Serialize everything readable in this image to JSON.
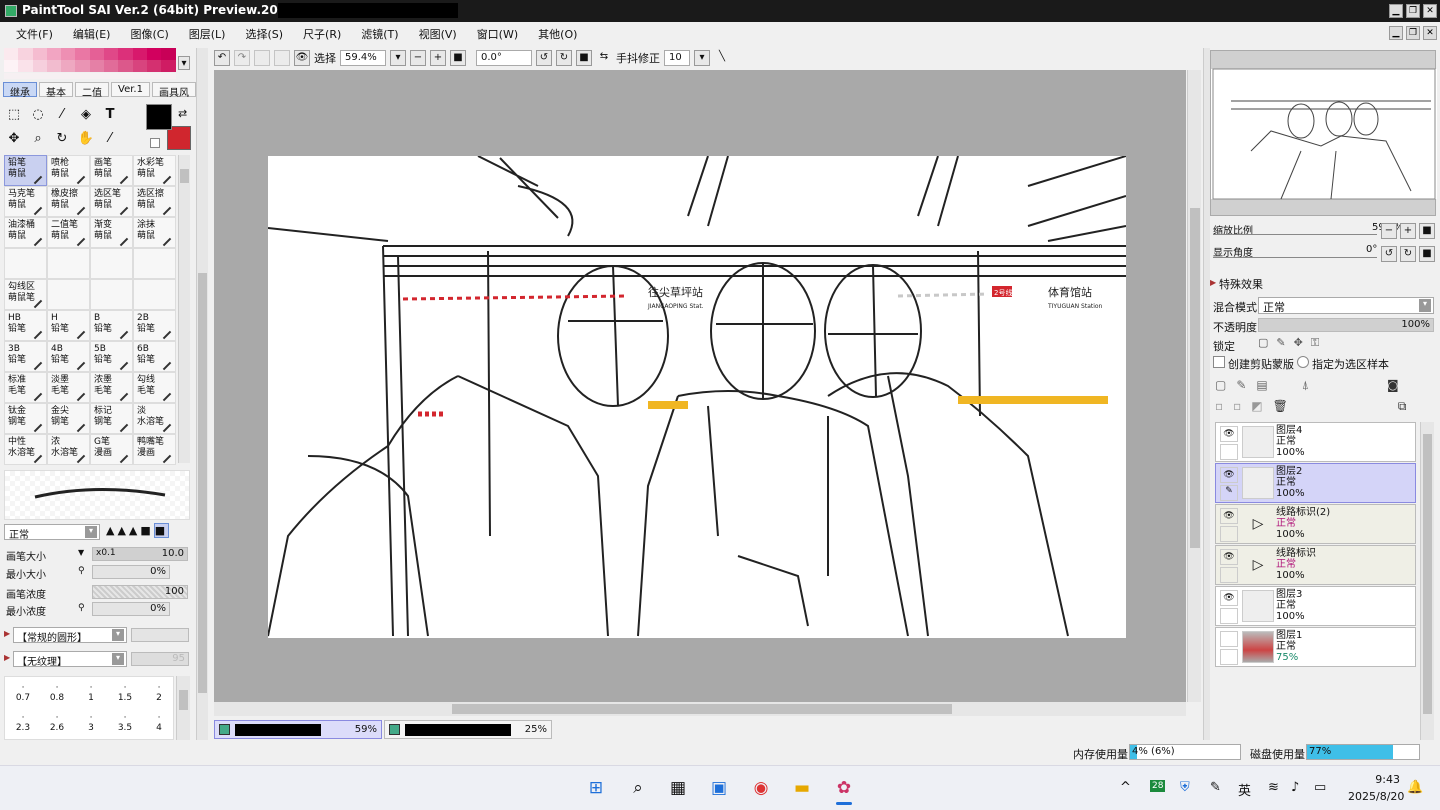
{
  "title": "PaintTool SAI Ver.2 (64bit) Preview.2024.05.22 -",
  "menu": [
    "文件(F)",
    "编辑(E)",
    "图像(C)",
    "图层(L)",
    "选择(S)",
    "尺子(R)",
    "滤镜(T)",
    "视图(V)",
    "窗口(W)",
    "其他(O)"
  ],
  "swatches": [
    "#fbe9ee",
    "#f8d3df",
    "#f5bcd0",
    "#f2a5c2",
    "#ee8fb3",
    "#ea77a4",
    "#e56096",
    "#e04888",
    "#dc307a",
    "#d8196c",
    "#d2005e",
    "#c80057",
    "#fdf3f6",
    "#fae2ea",
    "#f6cfdd",
    "#f2bccf",
    "#eea8c1",
    "#ea94b4",
    "#e580a6",
    "#e16c99",
    "#dc588b",
    "#d8447e",
    "#d43070",
    "#cf1c63"
  ],
  "tool_tabs": [
    "继承",
    "基本",
    "二值",
    "Ver.1",
    "画具风"
  ],
  "colors": {
    "primary": "#000000",
    "secondary": "#d0262e",
    "selection": "#c9d0f0"
  },
  "brushes": [
    {
      "name": "铅笔",
      "sub": "萌鼠",
      "selected": true
    },
    {
      "name": "喷枪",
      "sub": "萌鼠"
    },
    {
      "name": "画笔",
      "sub": "萌鼠"
    },
    {
      "name": "水彩笔",
      "sub": "萌鼠"
    },
    {
      "name": "马克笔",
      "sub": "萌鼠"
    },
    {
      "name": "橡皮擦",
      "sub": "萌鼠"
    },
    {
      "name": "选区笔",
      "sub": "萌鼠"
    },
    {
      "name": "选区擦",
      "sub": "萌鼠"
    },
    {
      "name": "油漆桶",
      "sub": "萌鼠"
    },
    {
      "name": "二值笔",
      "sub": "萌鼠"
    },
    {
      "name": "渐变",
      "sub": "萌鼠"
    },
    {
      "name": "涂抹",
      "sub": "萌鼠"
    },
    {
      "name": "",
      "sub": ""
    },
    {
      "name": "",
      "sub": ""
    },
    {
      "name": "",
      "sub": ""
    },
    {
      "name": "",
      "sub": ""
    },
    {
      "name": "勾线区",
      "sub": "萌鼠笔"
    },
    {
      "name": "",
      "sub": ""
    },
    {
      "name": "",
      "sub": ""
    },
    {
      "name": "",
      "sub": ""
    },
    {
      "name": "HB",
      "sub": "铅笔"
    },
    {
      "name": "H",
      "sub": "铅笔"
    },
    {
      "name": "B",
      "sub": "铅笔"
    },
    {
      "name": "2B",
      "sub": "铅笔"
    },
    {
      "name": "3B",
      "sub": "铅笔"
    },
    {
      "name": "4B",
      "sub": "铅笔"
    },
    {
      "name": "5B",
      "sub": "铅笔"
    },
    {
      "name": "6B",
      "sub": "铅笔"
    },
    {
      "name": "标准",
      "sub": "毛笔"
    },
    {
      "name": "淡墨",
      "sub": "毛笔"
    },
    {
      "name": "浓墨",
      "sub": "毛笔"
    },
    {
      "name": "勾线",
      "sub": "毛笔"
    },
    {
      "name": "钛金",
      "sub": "钢笔"
    },
    {
      "name": "金尖",
      "sub": "钢笔"
    },
    {
      "name": "标记",
      "sub": "钢笔"
    },
    {
      "name": "淡",
      "sub": "水溶笔"
    },
    {
      "name": "中性",
      "sub": "水溶笔"
    },
    {
      "name": "浓",
      "sub": "水溶笔"
    },
    {
      "name": "G笔",
      "sub": "漫画"
    },
    {
      "name": "鸭嘴笔",
      "sub": "漫画"
    }
  ],
  "brush_props": {
    "blend": "正常",
    "size_label": "画笔大小",
    "size_mult": "x0.1",
    "size_value": "10.0",
    "min_size_label": "最小大小",
    "min_size_value": "0%",
    "density_label": "画笔浓度",
    "density_value": "100",
    "min_density_label": "最小浓度",
    "min_density_value": "0%",
    "shape": "【常规的圆形】",
    "texture": "【无纹理】",
    "texture_val": "95"
  },
  "size_presets": [
    "0.7",
    "0.8",
    "1",
    "1.5",
    "2",
    "2.3",
    "2.6",
    "3",
    "3.5",
    "4"
  ],
  "toolbar": {
    "select_label": "选择",
    "zoom": "59.4%",
    "angle": "0.0°",
    "stabilizer_label": "手抖修正",
    "stabilizer": "10"
  },
  "docs": [
    {
      "pct": "59%"
    },
    {
      "pct": "25%"
    }
  ],
  "navigator": {
    "zoom_label": "缩放比例",
    "zoom": "59.4%",
    "angle_label": "显示角度",
    "angle": "0°"
  },
  "layer_panel": {
    "effects_label": "特殊效果",
    "blend_label": "混合模式",
    "blend": "正常",
    "opacity_label": "不透明度",
    "opacity": "100%",
    "lock_label": "锁定",
    "clip_label": "创建剪贴蒙版",
    "ref_label": "指定为选区样本"
  },
  "layers": [
    {
      "name": "图层4",
      "mode": "正常",
      "opacity": "100%",
      "type": "layer",
      "selected": false
    },
    {
      "name": "图层2",
      "mode": "正常",
      "opacity": "100%",
      "type": "layer",
      "selected": true
    },
    {
      "name": "线路标识(2)",
      "mode": "正常",
      "opacity": "100%",
      "type": "folder",
      "selected": false
    },
    {
      "name": "线路标识",
      "mode": "正常",
      "opacity": "100%",
      "type": "folder",
      "selected": false
    },
    {
      "name": "图层3",
      "mode": "正常",
      "opacity": "100%",
      "type": "layer",
      "selected": false
    },
    {
      "name": "图层1",
      "mode": "正常",
      "opacity": "75%",
      "type": "layer",
      "selected": false
    }
  ],
  "status": {
    "mem_label": "内存使用量",
    "mem": "4% (6%)",
    "disk_label": "磁盘使用量",
    "disk": "77%",
    "mem_frac": 0.06,
    "disk_frac": 0.77
  },
  "canvas_signs": {
    "left": "往尖草坪站",
    "left_en": "JIANCAOPING Stat.",
    "right": "体育馆站",
    "right_en": "TIYUGUAN Station",
    "line_badge": "2号线"
  },
  "taskbar": {
    "ime": "英",
    "time": "9:43",
    "date": "2025/8/20",
    "badge": "28"
  }
}
